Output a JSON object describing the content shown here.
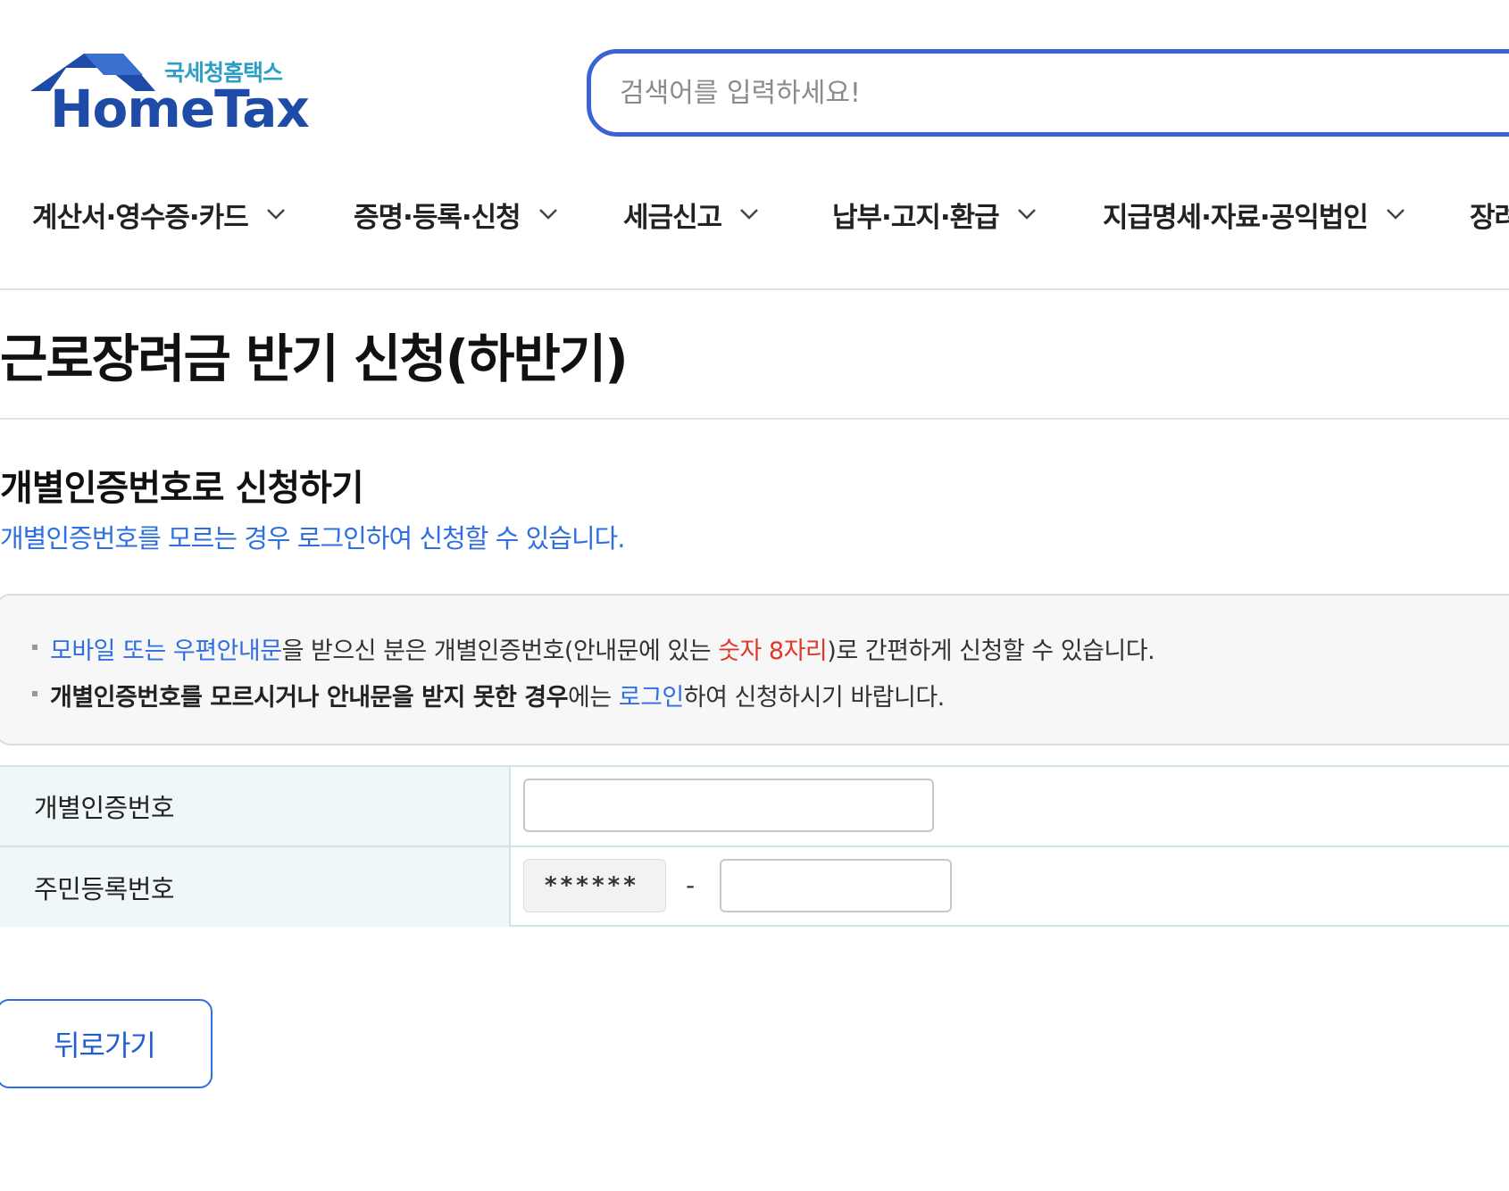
{
  "logo": {
    "sub": "국세청홈택스",
    "main": "HomeTax"
  },
  "search": {
    "placeholder": "검색어를 입력하세요!"
  },
  "nav": {
    "items": [
      {
        "label": "계산서·영수증·카드"
      },
      {
        "label": "증명·등록·신청"
      },
      {
        "label": "세금신고"
      },
      {
        "label": "납부·고지·환급"
      },
      {
        "label": "지급명세·자료·공익법인"
      },
      {
        "label": "장려"
      }
    ]
  },
  "page": {
    "title": "근로장려금 반기 신청(하반기)",
    "section_title": "개별인증번호로 신청하기",
    "section_sub": "개별인증번호를 모르는 경우 로그인하여 신청할 수 있습니다."
  },
  "notice": {
    "line1": {
      "a": "모바일 또는 우편안내문",
      "b": "을 받으신 분은 개별인증번호(안내문에 있는 ",
      "c": "숫자 8자리",
      "d": ")로 간편하게 신청할 수 있습니다."
    },
    "line2": {
      "a": "개별인증번호를 모르시거나 안내문을 받지 못한 경우",
      "b": "에는 ",
      "c": "로그인",
      "d": "하여 신청하시기 바랍니다."
    }
  },
  "form": {
    "auth_label": "개별인증번호",
    "auth_value": "",
    "rrn_label": "주민등록번호",
    "rrn_front": "******",
    "rrn_dash": "-",
    "rrn_back_value": ""
  },
  "buttons": {
    "back": "뒤로가기"
  },
  "colors": {
    "brand_blue": "#1e4aa8",
    "accent_blue": "#2f6fe0",
    "highlight_red": "#e0362c",
    "label_bg": "#eff7f8"
  }
}
